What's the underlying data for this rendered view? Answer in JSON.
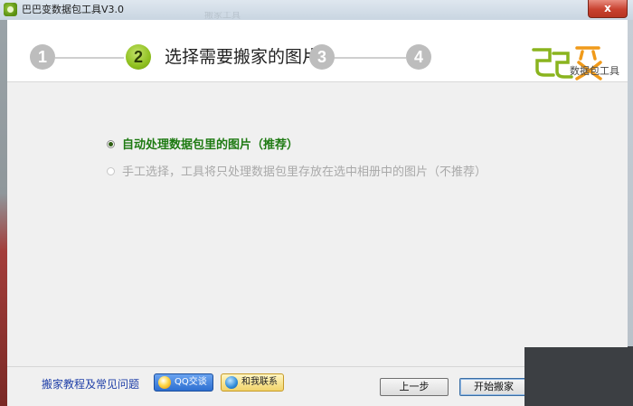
{
  "window": {
    "title": "巴巴变数据包工具V3.0",
    "ghost_title": "搬家工具",
    "close_label": "x"
  },
  "wizard": {
    "steps": [
      "1",
      "2",
      "3",
      "4"
    ],
    "active_step": 2,
    "active_title": "选择需要搬家的图片"
  },
  "logo": {
    "subtitle": "数据包工具"
  },
  "options": [
    {
      "label": "自动处理数据包里的图片（推荐）",
      "checked": true,
      "enabled": true
    },
    {
      "label": "手工选择，工具将只处理数据包里存放在选中相册中的图片（不推荐）",
      "checked": false,
      "enabled": false
    }
  ],
  "footer": {
    "help_link": "搬家教程及常见问题",
    "qq_button": "QQ交谈",
    "contact_button": "和我联系",
    "prev_button": "上一步",
    "start_button": "开始搬家"
  },
  "colors": {
    "accent_green": "#8fc01f",
    "option_green": "#1e7a12",
    "link_blue": "#1f3fa8",
    "close_red": "#c8412f"
  }
}
